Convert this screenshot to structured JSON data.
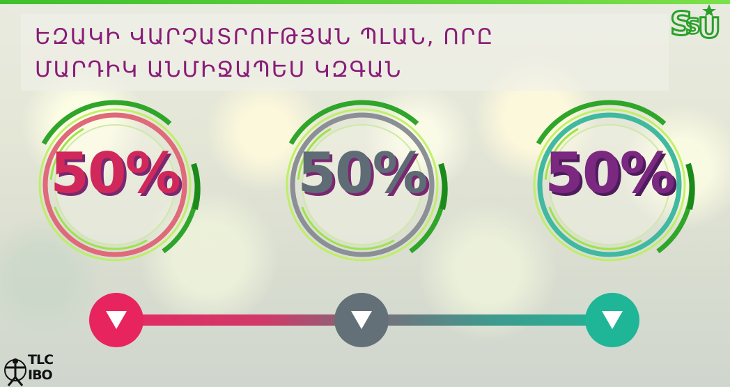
{
  "title": {
    "line1": "ԵԶԱԿԻ ՎԱՐՉԱՏՐՈՒԹՅԱՆ ՊԼԱՆ, ՈՐԸ",
    "line2": "ՄԱՐԴԻԿ ԱՆՄԻՋԱՊԵՍ ԿԶԳԱՆ"
  },
  "logo_top": {
    "text": "SSU"
  },
  "rings": [
    {
      "value": "50%",
      "color": "#d0285a",
      "ring_color": "#de6a7a"
    },
    {
      "value": "50%",
      "color": "#5f6b75",
      "ring_color": "#8a9095"
    },
    {
      "value": "50%",
      "color": "#7a2880",
      "ring_color": "#3fb9a0"
    }
  ],
  "markers": [
    {
      "color": "#e8245f",
      "icon": "triangle-down-icon"
    },
    {
      "color": "#647077",
      "icon": "triangle-down-icon"
    },
    {
      "color": "#1fb597",
      "icon": "triangle-down-icon"
    }
  ],
  "logo_bottom": {
    "line1": "TLC",
    "line2": "IBO"
  }
}
